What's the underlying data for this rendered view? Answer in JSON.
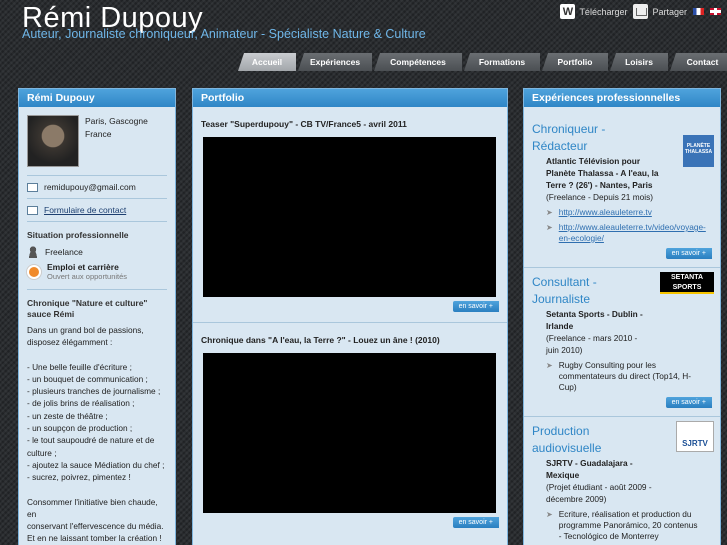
{
  "header": {
    "title": "Rémi Dupouy",
    "subtitle": "Auteur, Journaliste chroniqueur, Animateur - Spécialiste Nature & Culture",
    "download_label": "Télécharger",
    "share_label": "Partager"
  },
  "nav": {
    "tabs": [
      {
        "label": "Accueil",
        "active": true
      },
      {
        "label": "Expériences"
      },
      {
        "label": "Compétences"
      },
      {
        "label": "Formations"
      },
      {
        "label": "Portfolio"
      },
      {
        "label": "Loisirs"
      },
      {
        "label": "Contact"
      }
    ]
  },
  "profile": {
    "panel_title": "Rémi Dupouy",
    "location_city": "Paris, Gascogne",
    "location_country": "France",
    "email": "remidupouy@gmail.com",
    "contact_form": "Formulaire de contact",
    "situation_title": "Situation professionnelle",
    "situation_value": "Freelance",
    "job_search_title": "Emploi et carrière",
    "job_search_sub": "Ouvert aux opportunités",
    "blurb_title": "Chronique \"Nature et culture\" sauce Rémi",
    "blurb_lines": [
      "Dans un grand bol de passions,",
      "disposez élégamment :",
      "",
      "- Une belle feuille d'écriture ;",
      "- un bouquet de communication ;",
      "- plusieurs tranches de journalisme ;",
      "- de jolis brins de réalisation ;",
      "- un zeste de théâtre ;",
      "- un soupçon de production ;",
      "- le tout saupoudré de nature et de",
      "culture ;",
      "- ajoutez la sauce Médiation du chef ;",
      "- sucrez, poivrez, pimentez !",
      "",
      "Consommer l'initiative bien chaude, en",
      "conservant l'effervescence du média.",
      "Et en ne laissant tomber la création !"
    ]
  },
  "portfolio": {
    "panel_title": "Portfolio",
    "more_label": "en savoir +",
    "videos": [
      {
        "title": "Teaser \"Superdupouy\" - CB TV/France5 - avril 2011"
      },
      {
        "title": "Chronique dans \"A l'eau, la Terre ?\" - Louez un âne ! (2010)"
      }
    ]
  },
  "experiences": {
    "panel_title": "Expériences professionnelles",
    "more_label": "en savoir +",
    "jobs": [
      {
        "role": "Chroniqueur - Rédacteur",
        "company": "Atlantic Télévision pour Planète Thalassa - A l'eau, la Terre ? (26') - Nantes, Paris",
        "period": "(Freelance - Depuis 21 mois)",
        "logo_text": "PLANÈTE THALASSA",
        "items": [
          "http://www.aleauleterre.tv",
          "http://www.aleauleterre.tv/video/voyage-en-ecologie/"
        ]
      },
      {
        "role": "Consultant - Journaliste",
        "company": "Setanta Sports - Dublin - Irlande",
        "period": "(Freelance - mars 2010 - juin 2010)",
        "logo_text": "SETANTA SPORTS",
        "items": [
          "Rugby Consulting pour les commentateurs du direct (Top14, H-Cup)"
        ]
      },
      {
        "role": "Production audiovisuelle",
        "company": "SJRTV - Guadalajara - Mexique",
        "period": "(Projet étudiant - août 2009 - décembre 2009)",
        "logo_text": "SJRTV",
        "items": [
          "Ecriture, réalisation et production du programme Panorámico, 20 contenus - Tecnológico de Monterrey"
        ]
      }
    ]
  }
}
